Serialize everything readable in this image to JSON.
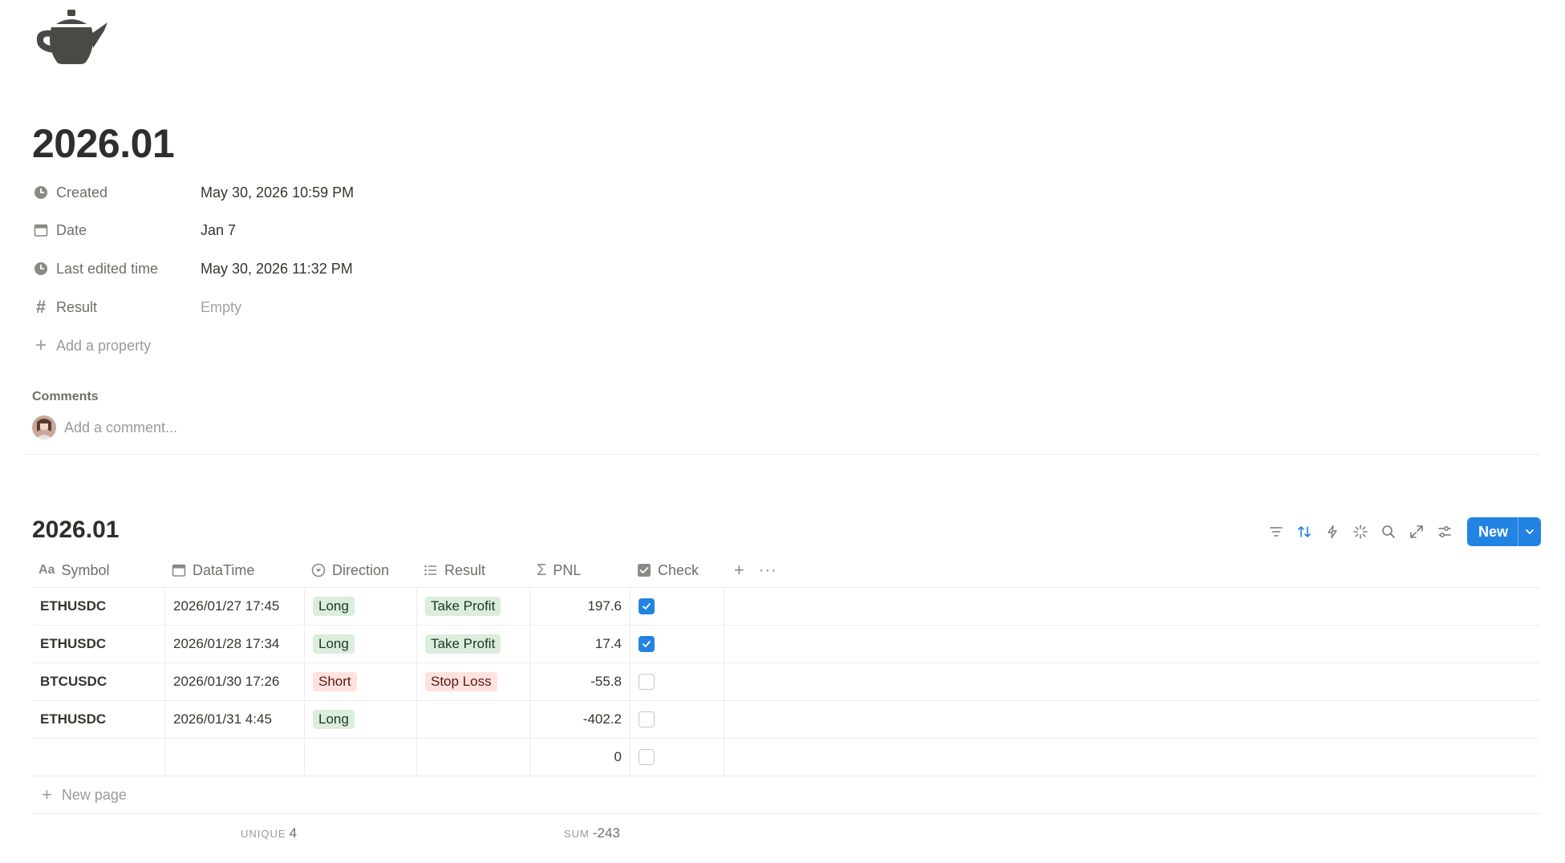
{
  "page": {
    "icon": "teapot-icon",
    "title": "2026.01"
  },
  "properties": [
    {
      "icon": "clock-icon",
      "label": "Created",
      "value": "May 30, 2026 10:59 PM",
      "empty": false
    },
    {
      "icon": "calendar-icon",
      "label": "Date",
      "value": "Jan 7",
      "empty": false
    },
    {
      "icon": "clock-icon",
      "label": "Last edited time",
      "value": "May 30, 2026 11:32 PM",
      "empty": false
    },
    {
      "icon": "hash-icon",
      "label": "Result",
      "value": "Empty",
      "empty": true
    }
  ],
  "add_property": "Add a property",
  "comments": {
    "title": "Comments",
    "placeholder": "Add a comment..."
  },
  "database": {
    "title": "2026.01",
    "new_button": "New",
    "columns": [
      {
        "icon": "text-icon",
        "label": "Symbol"
      },
      {
        "icon": "calendar-icon",
        "label": "DataTime"
      },
      {
        "icon": "select-icon",
        "label": "Direction"
      },
      {
        "icon": "list-icon",
        "label": "Result"
      },
      {
        "icon": "sigma-icon",
        "label": "PNL"
      },
      {
        "icon": "checkbox-icon",
        "label": "Check"
      }
    ],
    "rows": [
      {
        "symbol": "ETHUSDC",
        "datetime": "2026/01/27 17:45",
        "direction": "Long",
        "direction_color": "green",
        "result": "Take Profit",
        "result_color": "green",
        "pnl": "197.6",
        "check": true
      },
      {
        "symbol": "ETHUSDC",
        "datetime": "2026/01/28 17:34",
        "direction": "Long",
        "direction_color": "green",
        "result": "Take Profit",
        "result_color": "green",
        "pnl": "17.4",
        "check": true
      },
      {
        "symbol": "BTCUSDC",
        "datetime": "2026/01/30 17:26",
        "direction": "Short",
        "direction_color": "red",
        "result": "Stop Loss",
        "result_color": "red",
        "pnl": "-55.8",
        "check": false
      },
      {
        "symbol": "ETHUSDC",
        "datetime": "2026/01/31 4:45",
        "direction": "Long",
        "direction_color": "green",
        "result": "",
        "result_color": "",
        "pnl": "-402.2",
        "check": false
      },
      {
        "symbol": "",
        "datetime": "",
        "direction": "",
        "direction_color": "",
        "result": "",
        "result_color": "",
        "pnl": "0",
        "check": false
      }
    ],
    "new_page": "New page",
    "footer": {
      "unique_label": "UNIQUE",
      "unique_value": "4",
      "sum_label": "SUM",
      "sum_value": "-243"
    }
  },
  "colors": {
    "accent": "#2383e2",
    "tag_green_bg": "#dbeddb",
    "tag_red_bg": "#ffe2dd"
  }
}
